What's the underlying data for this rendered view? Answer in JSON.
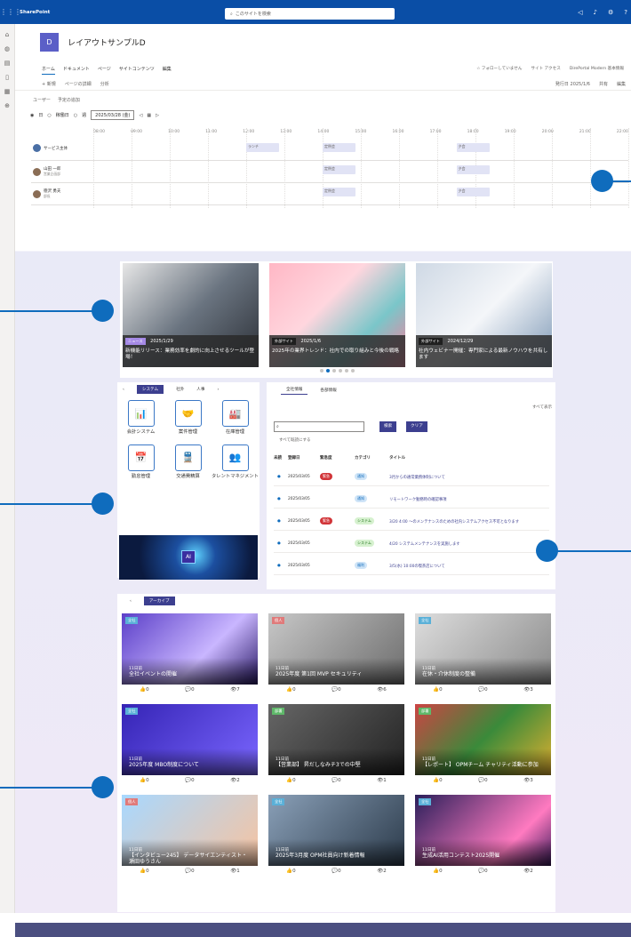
{
  "topbar": {
    "brand": "SharePoint",
    "search_placeholder": "このサイトを検索"
  },
  "site": {
    "logo_letter": "D",
    "title": "レイアウトサンプルD"
  },
  "nav": [
    "ホーム",
    "ドキュメント",
    "ページ",
    "サイトコンテンツ",
    "編集"
  ],
  "site_actions": [
    "☆ フォローしていません",
    "サイト アクセス",
    "DirePortal Modern 基本情報"
  ],
  "cmd": {
    "new": "+ 新規",
    "page_detail": "ページの詳細",
    "analytics": "分析",
    "published": "発行日 2025/1/6",
    "share": "共有",
    "edit": "編集"
  },
  "schedule": {
    "user_label": "ユーザー",
    "today_plan": "予定の追加",
    "view_day": "日",
    "view_workweek": "稼働日",
    "view_week": "週",
    "date": "2025/03/28 (金)",
    "hours": [
      "08:00",
      "09:00",
      "10:00",
      "11:00",
      "12:00",
      "13:00",
      "14:00",
      "15:00",
      "16:00",
      "17:00",
      "18:00",
      "19:00",
      "20:00",
      "21:00",
      "22:00"
    ],
    "people": [
      {
        "name": "サービス主体",
        "sub": "",
        "slots": [
          {
            "label": "ランチ",
            "h": 12
          },
          {
            "label": "定例会",
            "h": 14
          },
          {
            "label": "夕会",
            "h": 17.5
          }
        ]
      },
      {
        "name": "山田 一郎",
        "sub": "営業企画部",
        "slots": [
          {
            "label": "定例会",
            "h": 14
          },
          {
            "label": "夕会",
            "h": 17.5
          }
        ]
      },
      {
        "name": "徳沢 勇夫",
        "sub": "部長",
        "slots": [
          {
            "label": "定例会",
            "h": 14
          },
          {
            "label": "夕会",
            "h": 17.5
          }
        ]
      }
    ]
  },
  "carousel": [
    {
      "tag": "ニュース",
      "date": "2025/1/29",
      "title": "新機能リリース：業務効率を劇的に向上させるツールが登場！"
    },
    {
      "tag": "外部サイト",
      "date": "2025/1/6",
      "title": "2025年の業界トレンド：社内での取り組みと今後の戦略"
    },
    {
      "tag": "外部サイト",
      "date": "2024/12/29",
      "title": "社内ウェビナー開催：専門家による最新ノウハウを共有します"
    }
  ],
  "apps": {
    "tabs": [
      "システム",
      "社外",
      "人事"
    ],
    "items": [
      {
        "icon": "📊",
        "label": "会計システム"
      },
      {
        "icon": "🤝",
        "label": "案件管理"
      },
      {
        "icon": "🏭",
        "label": "在庫管理"
      },
      {
        "icon": "📅",
        "label": "勤怠管理"
      },
      {
        "icon": "🚆",
        "label": "交通費精算"
      },
      {
        "icon": "👥",
        "label": "タレントマネジメント"
      }
    ],
    "banner_text": "AI"
  },
  "news": {
    "tabs": [
      "全社情報",
      "各部情報"
    ],
    "see_all": "すべて表示",
    "search_btn": "検索",
    "clear_btn": "クリア",
    "mark_read": "すべて既読にする",
    "cols": [
      "未読",
      "登録日",
      "緊急度",
      "カテゴリ",
      "タイトル"
    ],
    "rows": [
      {
        "date": "2025/03/05",
        "urgent": "緊急",
        "cat": "通知",
        "cat_type": "b",
        "title": "3月からの通常業務体制について"
      },
      {
        "date": "2025/03/05",
        "urgent": "",
        "cat": "通知",
        "cat_type": "b",
        "title": "リモートワーク勤務時の確認事項"
      },
      {
        "date": "2025/03/05",
        "urgent": "緊急",
        "cat": "システム",
        "cat_type": "g",
        "title": "3/20 4:00 ～のメンテナンスのための社内システムアクセス不可となります"
      },
      {
        "date": "2025/03/05",
        "urgent": "",
        "cat": "システム",
        "cat_type": "g",
        "title": "4/20 システムメンテナンスを実施します"
      },
      {
        "date": "2025/03/05",
        "urgent": "",
        "cat": "福利",
        "cat_type": "b",
        "title": "3/5(水) 10:00の喫茶店について"
      }
    ]
  },
  "archive": {
    "tab": "アーカイブ",
    "cards": [
      {
        "badge": "全社",
        "date": "11日前",
        "title": "全社イベントの開催",
        "likes": "0",
        "comments": "0",
        "views": "7",
        "bg": "linear-gradient(135deg,#5b3fc8,#c9b6ff 60%,#2a1a66)"
      },
      {
        "badge": "個人",
        "date": "11日前",
        "title": "2025年度 第1回 MVP セキュリティ",
        "likes": "0",
        "comments": "0",
        "views": "6",
        "bg": "linear-gradient(135deg,#c7c7c7,#6d6d6d)"
      },
      {
        "badge": "全社",
        "date": "11日前",
        "title": "在休・介休制度の整備",
        "likes": "0",
        "comments": "0",
        "views": "3",
        "bg": "linear-gradient(135deg,#ddd,#8a8a8a)"
      },
      {
        "badge": "全社",
        "date": "11日前",
        "title": "2025年度 MBO制度について",
        "likes": "0",
        "comments": "0",
        "views": "2",
        "bg": "linear-gradient(135deg,#3524b5,#7a66ff)"
      },
      {
        "badge": "部署",
        "date": "11日前",
        "title": "【営業部】 昇だしなみチ3での中堅",
        "likes": "0",
        "comments": "0",
        "views": "1",
        "bg": "linear-gradient(135deg,#666,#222)"
      },
      {
        "badge": "部署",
        "date": "11日前",
        "title": "【レポート】 OPMチーム チャリティ活動に参加",
        "likes": "0",
        "comments": "0",
        "views": "3",
        "bg": "linear-gradient(135deg,#c44,#3a8a3a,#e0b030)"
      },
      {
        "badge": "個人",
        "date": "11日前",
        "title": "【インタビュー245】 データサイエンティスト・瀬田ゆうさん",
        "likes": "0",
        "comments": "0",
        "views": "1",
        "bg": "linear-gradient(135deg,#a8d8ff,#f7c3a0)"
      },
      {
        "badge": "全社",
        "date": "11日前",
        "title": "2025年3月度 OPM社員向け新着情報",
        "likes": "0",
        "comments": "0",
        "views": "2",
        "bg": "linear-gradient(135deg,#8aa0b8,#2b3a4a)"
      },
      {
        "badge": "全社",
        "date": "11日前",
        "title": "生成AI活用コンテスト2025開催",
        "likes": "0",
        "comments": "0",
        "views": "2",
        "bg": "linear-gradient(135deg,#2a1f5a,#ff7ac0 70%,#3a1a5a)"
      }
    ]
  },
  "colors": {
    "accent": "#0f6cbd",
    "brand": "#3c3f8f",
    "suite": "#0a4ea6"
  }
}
